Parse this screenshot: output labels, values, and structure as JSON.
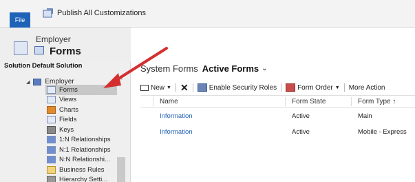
{
  "ribbon": {
    "file_label": "File",
    "publish_label": "Publish All Customizations"
  },
  "header": {
    "entity_name": "Employer",
    "page_title": "Forms"
  },
  "sidebar": {
    "solution_label": "Solution Default Solution",
    "root_item": "Employer",
    "items": [
      {
        "label": "Forms",
        "icon": "forms-icon",
        "selected": true
      },
      {
        "label": "Views",
        "icon": "views-icon"
      },
      {
        "label": "Charts",
        "icon": "charts-icon"
      },
      {
        "label": "Fields",
        "icon": "fields-icon"
      },
      {
        "label": "Keys",
        "icon": "keys-icon"
      },
      {
        "label": "1:N Relationships",
        "icon": "relationship-icon"
      },
      {
        "label": "N:1 Relationships",
        "icon": "relationship-icon"
      },
      {
        "label": "N:N Relationshi...",
        "icon": "relationship-icon"
      },
      {
        "label": "Business Rules",
        "icon": "business-rules-icon"
      },
      {
        "label": "Hierarchy Setti...",
        "icon": "hierarchy-icon"
      }
    ]
  },
  "main": {
    "system_forms_label": "System Forms",
    "view_selector": "Active Forms",
    "toolbar": {
      "new_label": "New",
      "enable_security_label": "Enable Security Roles",
      "form_order_label": "Form Order",
      "more_actions_label": "More Action"
    },
    "grid": {
      "columns": [
        "Name",
        "Form State",
        "Form Type ↑"
      ],
      "rows": [
        {
          "name": "Information",
          "state": "Active",
          "type": "Main"
        },
        {
          "name": "Information",
          "state": "Active",
          "type": "Mobile - Express"
        }
      ]
    }
  },
  "colors": {
    "file_button": "#1f63b8",
    "link": "#1f5fb3",
    "arrow": "#d32f2f"
  }
}
